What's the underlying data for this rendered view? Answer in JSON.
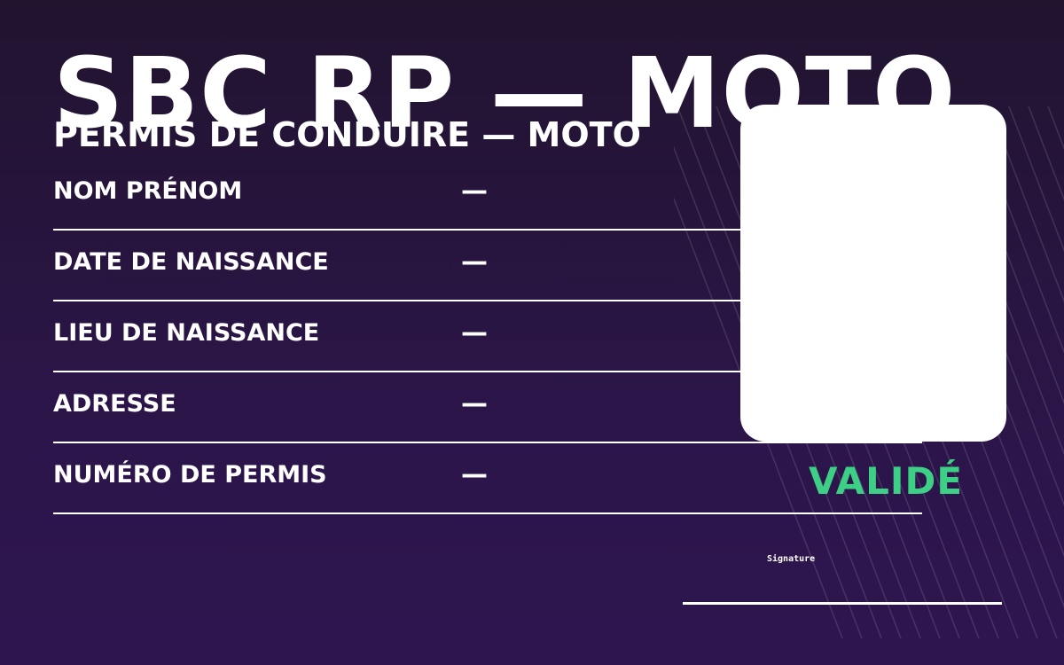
{
  "card": {
    "title": "SBC RP — MOTO",
    "subtitle": "PERMIS DE CONDUIRE — MOTO",
    "fields": [
      {
        "label": "NOM PRÉNOM",
        "value": "—"
      },
      {
        "label": "DATE DE NAISSANCE",
        "value": "—"
      },
      {
        "label": "LIEU DE NAISSANCE",
        "value": "—"
      },
      {
        "label": "ADRESSE",
        "value": "—"
      },
      {
        "label": "NUMÉRO DE PERMIS",
        "value": "—"
      }
    ],
    "status": "VALIDÉ",
    "signature_label": "Signature"
  },
  "colors": {
    "background_top": "#21142f",
    "background_bottom": "#2e1550",
    "text": "#ffffff",
    "status": "#3ecf86"
  }
}
